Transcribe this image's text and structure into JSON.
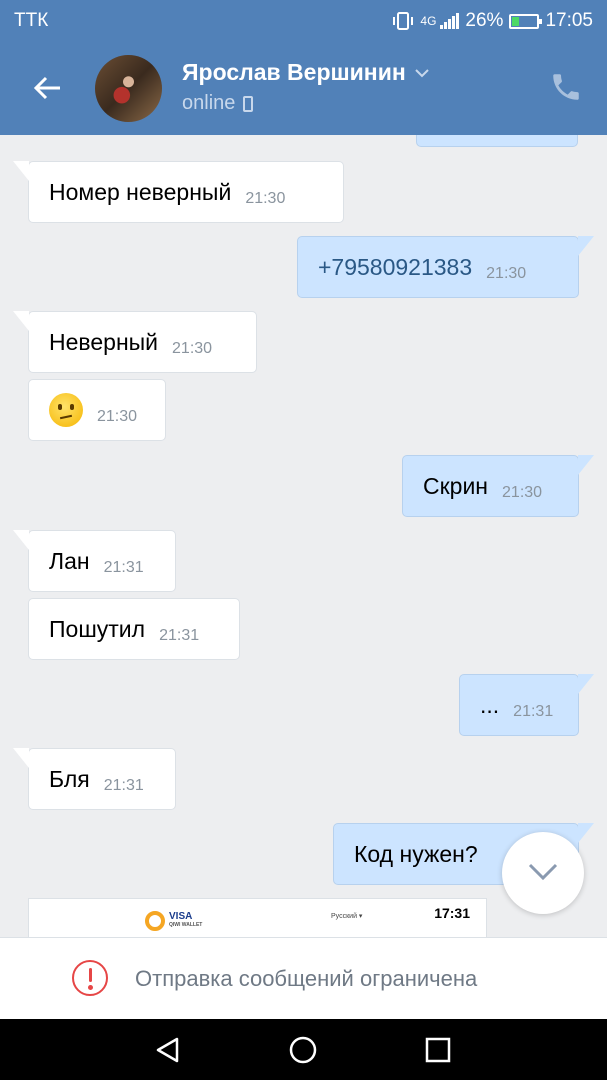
{
  "status_bar": {
    "carrier": "ТТК",
    "network": "4G",
    "battery_percent": "26%",
    "battery_level": 0.26,
    "time": "17:05"
  },
  "header": {
    "contact_name": "Ярослав Вершинин",
    "status": "online",
    "icons": [
      "back-arrow-icon",
      "chevron-down-icon",
      "mobile-icon",
      "phone-icon"
    ]
  },
  "messages": [
    {
      "side": "in",
      "text": "Номер неверный",
      "time": "21:30"
    },
    {
      "side": "out",
      "text": "+79580921383",
      "time": "21:30"
    },
    {
      "side": "in",
      "text": "Неверный",
      "time": "21:30"
    },
    {
      "side": "in",
      "emoji": "confused-face",
      "time": "21:30"
    },
    {
      "side": "out",
      "text": "Скрин",
      "time": "21:30"
    },
    {
      "side": "in",
      "text": "Лан",
      "time": "21:31"
    },
    {
      "side": "in",
      "text": "Пошутил",
      "time": "21:31"
    },
    {
      "side": "out",
      "text": "...",
      "time": "21:31"
    },
    {
      "side": "in",
      "text": "Бля",
      "time": "21:31"
    },
    {
      "side": "out",
      "text": "Код нужен?",
      "time": ""
    }
  ],
  "preview": {
    "brand": "VISA",
    "brand_sub": "QIWI WALLET",
    "language": "Русский ▾",
    "time": "17:31"
  },
  "footer": {
    "restricted_text": "Отправка сообщений ограничена"
  },
  "colors": {
    "header_blue": "#5181b8",
    "outgoing_bubble": "#cce4ff",
    "incoming_bubble": "#ffffff",
    "chat_background": "#edeef0",
    "warning_red": "#e64646"
  }
}
